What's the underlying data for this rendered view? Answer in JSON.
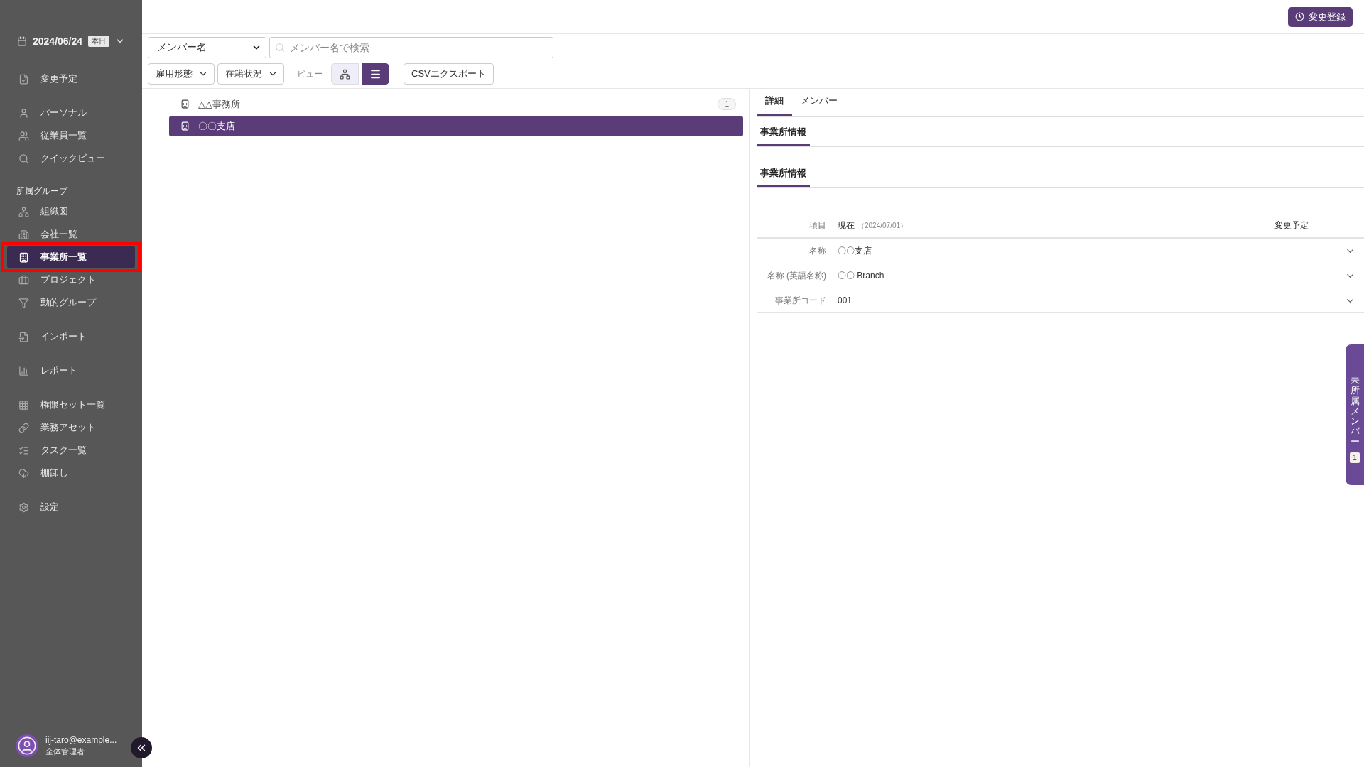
{
  "sidebar": {
    "date": "2024/06/24",
    "today_badge": "本日",
    "groups": [
      {
        "items": [
          {
            "label": "変更予定",
            "selected": false,
            "annotated": false
          }
        ]
      },
      {
        "items": [
          {
            "label": "パーソナル",
            "selected": false,
            "annotated": false
          },
          {
            "label": "従業員一覧",
            "selected": false,
            "annotated": false
          },
          {
            "label": "クイックビュー",
            "selected": false,
            "annotated": false
          }
        ]
      },
      {
        "label": "所属グループ",
        "items": [
          {
            "label": "組織図",
            "selected": false,
            "annotated": false
          },
          {
            "label": "会社一覧",
            "selected": false,
            "annotated": false
          },
          {
            "label": "事業所一覧",
            "selected": true,
            "annotated": true
          },
          {
            "label": "プロジェクト",
            "selected": false,
            "annotated": false
          },
          {
            "label": "動的グループ",
            "selected": false,
            "annotated": false
          }
        ]
      },
      {
        "items": [
          {
            "label": "インポート",
            "selected": false,
            "annotated": false
          }
        ]
      },
      {
        "items": [
          {
            "label": "レポート",
            "selected": false,
            "annotated": false
          }
        ]
      },
      {
        "items": [
          {
            "label": "権限セット一覧",
            "selected": false,
            "annotated": false
          },
          {
            "label": "業務アセット",
            "selected": false,
            "annotated": false
          },
          {
            "label": "タスク一覧",
            "selected": false,
            "annotated": false
          },
          {
            "label": "棚卸し",
            "selected": false,
            "annotated": false
          }
        ]
      },
      {
        "items": [
          {
            "label": "設定",
            "selected": false,
            "annotated": false
          }
        ]
      }
    ],
    "user": {
      "email": "iij-taro@example...",
      "role": "全体管理者"
    }
  },
  "header": {
    "register_button": "変更登録"
  },
  "toolbar": {
    "search_by": "メンバー名",
    "search": {
      "placeholder": "メンバー名で検索"
    },
    "filters": [
      "雇用形態",
      "在籍状況"
    ],
    "view_label": "ビュー",
    "views": [
      {
        "selected": false
      },
      {
        "selected": true
      }
    ],
    "export_button": "CSVエクスポート"
  },
  "tree": [
    {
      "label": "△△事務所",
      "count": "1",
      "selected": false
    },
    {
      "label": "〇〇支店",
      "selected": true
    }
  ],
  "detail": {
    "tabs": [
      {
        "label": "詳細",
        "selected": true
      },
      {
        "label": "メンバー",
        "selected": false
      }
    ],
    "subtab": "事業所情報",
    "section_title": "事業所情報",
    "table": {
      "columns": [
        "項目",
        "現在",
        "（2024/07/01）",
        "変更予定"
      ],
      "rows": [
        {
          "label": "名称",
          "value": "〇〇支店"
        },
        {
          "label": "名称 (英語名称)",
          "value": "〇〇 Branch"
        },
        {
          "label": "事業所コード",
          "value": "001"
        }
      ]
    }
  },
  "side_tab": {
    "label": "未所属メンバー",
    "count": "1"
  }
}
